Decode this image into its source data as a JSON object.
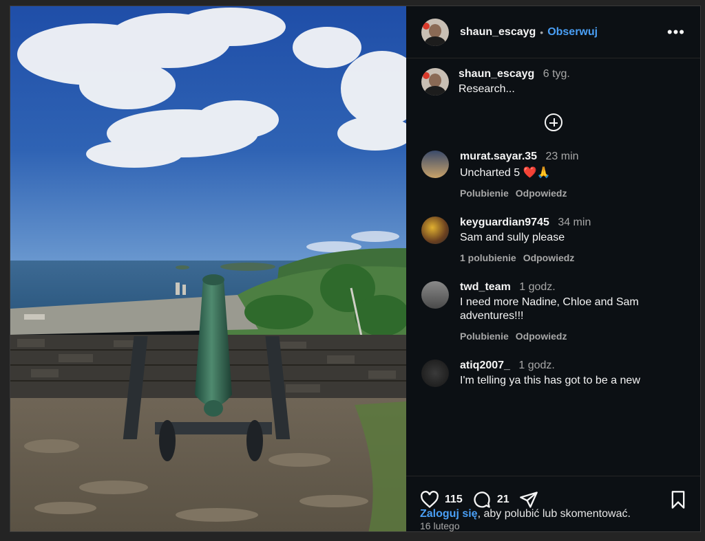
{
  "post": {
    "author": "shaun_escayg",
    "separator": "•",
    "follow_label": "Obserwuj",
    "more_icon": "more-horizontal-icon",
    "caption": {
      "time": "6 tyg.",
      "text": "Research..."
    },
    "likes_count": "115",
    "comments_count": "21",
    "date": "16 lutego"
  },
  "comments": [
    {
      "user": "murat.sayar.35",
      "time": "23 min",
      "text": "Uncharted 5 ❤️🙏",
      "likes": "Polubienie",
      "reply": "Odpowiedz"
    },
    {
      "user": "keyguardian9745",
      "time": "34 min",
      "text": "Sam and sully please",
      "likes": "1 polubienie",
      "reply": "Odpowiedz"
    },
    {
      "user": "twd_team",
      "time": "1 godz.",
      "text_line1": "I need more Nadine, Chloe and Sam",
      "text_line2": "adventures!!!",
      "likes": "Polubienie",
      "reply": "Odpowiedz"
    },
    {
      "user": "atiq2007_",
      "time": "1 godz.",
      "text": "I'm telling ya this has got to be a new"
    }
  ],
  "login": {
    "link": "Zaloguj się",
    "rest": ", aby polubić lub skomentować."
  },
  "colors": {
    "accent": "#4a9ff5",
    "background": "#0c1014",
    "muted": "#a8a8a8"
  }
}
